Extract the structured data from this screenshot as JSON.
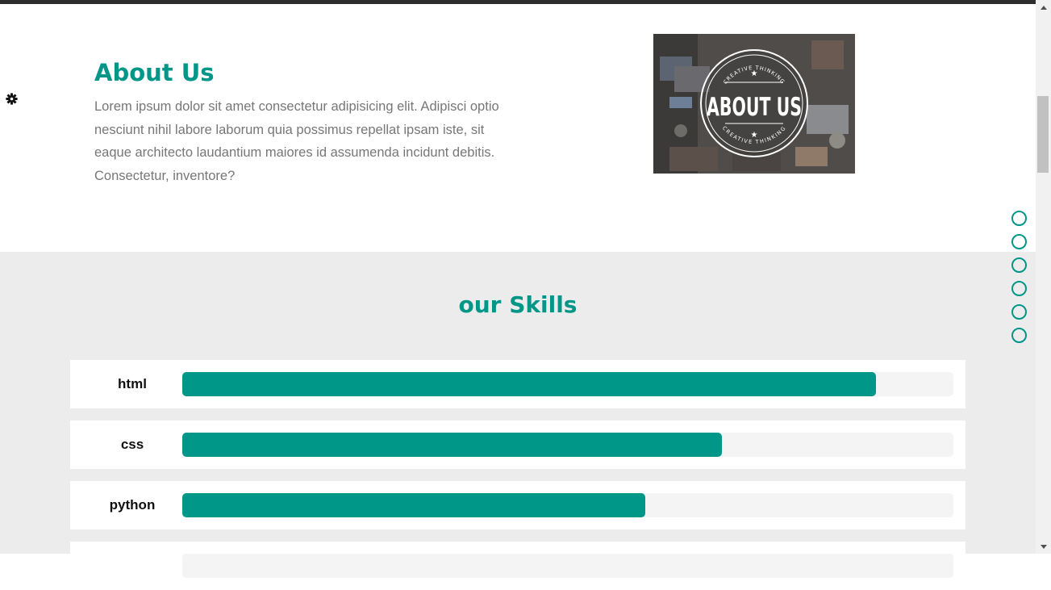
{
  "settings": {
    "icon": "gear-icon"
  },
  "about": {
    "title": "About Us",
    "text": "Lorem ipsum dolor sit amet consectetur adipisicing elit. Adipisci optio nesciunt nihil labore laborum quia possimus repellat ipsam iste, sit eaque architecto laudantium maiores id assumenda incidunt debitis. Consectetur, inventore?",
    "image": {
      "badge_top_text": "CREATIVE THINKING",
      "badge_main_text": "ABOUT US",
      "badge_bottom_text": "CREATIVE THINKING"
    }
  },
  "skills": {
    "title": "our Skills",
    "items": [
      {
        "name": "html",
        "percent": 90
      },
      {
        "name": "css",
        "percent": 70
      },
      {
        "name": "python",
        "percent": 60
      },
      {
        "name": "",
        "percent": 0
      }
    ]
  },
  "side_nav": {
    "bullet_count": 6
  },
  "colors": {
    "accent": "#009688",
    "skills_background": "#ececec",
    "text_muted": "#777777"
  }
}
